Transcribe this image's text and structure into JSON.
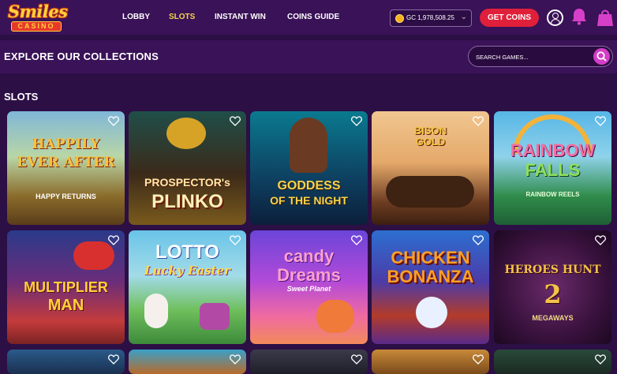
{
  "brand": {
    "line1": "Smiles",
    "line2": "CASINO"
  },
  "nav": [
    {
      "label": "LOBBY"
    },
    {
      "label": "SLOTS",
      "active": true
    },
    {
      "label": "INSTANT WIN"
    },
    {
      "label": "COINS GUIDE"
    }
  ],
  "balance": {
    "currency": "GC",
    "amount": "1,978,508.25",
    "text": "GC 1,978,508.25"
  },
  "get_coins_label": "GET COINS",
  "explore_title": "EXPLORE OUR COLLECTIONS",
  "search": {
    "placeholder": "SEARCH GAMES..."
  },
  "section_title": "SLOTS",
  "colors": {
    "bg": "#2c0f45",
    "bar": "#3a1257",
    "accent": "#e0203a",
    "active_nav": "#f4d34a",
    "search_btn": "#d23ec6"
  },
  "games": [
    {
      "line1": "HAPPILY",
      "line2": "EVER AFTER",
      "sub": "HAPPY RETURNS"
    },
    {
      "line1": "PROSPECTOR's",
      "line2": "PLINKO",
      "sub": ""
    },
    {
      "line1": "GODDESS",
      "line2": "OF THE NIGHT",
      "sub": ""
    },
    {
      "line1": "BISON",
      "line2": "GOLD",
      "sub": ""
    },
    {
      "line1": "RAINBOW",
      "line2": "FALLS",
      "sub": "RAINBOW REELS"
    },
    {
      "line1": "MULTIPLIER",
      "line2": "MAN",
      "sub": ""
    },
    {
      "line1": "LOTTO",
      "line2": "Lucky Easter",
      "sub": ""
    },
    {
      "line1": "candy",
      "line2": "Dreams",
      "sub": "Sweet Planet"
    },
    {
      "line1": "CHICKEN",
      "line2": "BONANZA",
      "sub": ""
    },
    {
      "line1": "HEROES HUNT",
      "line2": "2",
      "sub": "MEGAWAYS"
    }
  ]
}
